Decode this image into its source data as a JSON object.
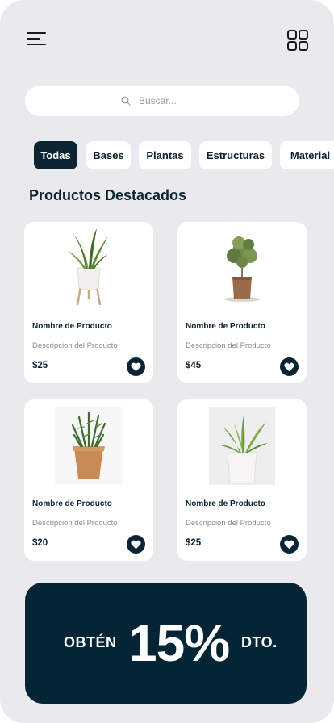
{
  "header": {
    "menu_icon": "hamburger-menu-icon",
    "grid_icon": "grid-view-icon"
  },
  "search": {
    "placeholder": "Buscar...",
    "icon": "search-icon"
  },
  "categories": [
    {
      "label": "Todas",
      "active": true
    },
    {
      "label": "Bases",
      "active": false
    },
    {
      "label": "Plantas",
      "active": false
    },
    {
      "label": "Estructuras",
      "active": false
    },
    {
      "label": "Material",
      "active": false
    }
  ],
  "section": {
    "title": "Productos Destacados"
  },
  "products": [
    {
      "name": "Nombre de Producto",
      "description": "Descripcion del Producto",
      "price": "$25",
      "image": "snake-plant-on-stand"
    },
    {
      "name": "Nombre de Producto",
      "description": "Descripcion del Producto",
      "price": "$45",
      "image": "olive-tree-in-cork-pot"
    },
    {
      "name": "Nombre de Producto",
      "description": "Descripcion del Producto",
      "price": "$20",
      "image": "rosemary-in-terracotta-pot"
    },
    {
      "name": "Nombre de Producto",
      "description": "Descripcion del Producto",
      "price": "$25",
      "image": "aloe-in-white-pot"
    }
  ],
  "promo": {
    "prefix": "OBTÉN",
    "value": "15%",
    "suffix": "DTO."
  },
  "colors": {
    "background": "#eaeaee",
    "primary": "#0b2434",
    "card": "#ffffff",
    "muted_text": "#8a8a8a"
  }
}
